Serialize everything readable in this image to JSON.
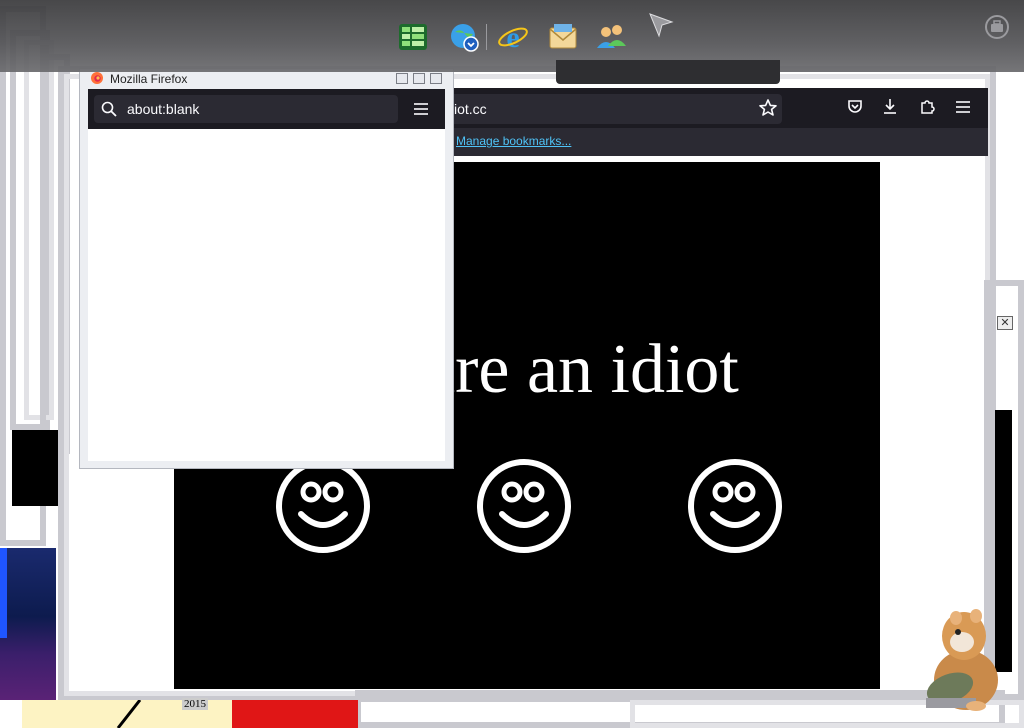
{
  "taskbar": {
    "icons": [
      "spreadsheet-icon",
      "globe-download-icon",
      "internet-explorer-icon",
      "mail-icon",
      "users-icon"
    ]
  },
  "main_browser": {
    "url": "iot.cc",
    "bookmarks_link": "Manage bookmarks...",
    "page_text": "are an idiot"
  },
  "popup_browser": {
    "title": "Mozilla Firefox",
    "url": "about:blank"
  },
  "bottom": {
    "year": "2015"
  },
  "colors": {
    "firefox_toolbar": "#1c1b22",
    "url_bar": "#2b2a33",
    "link": "#4fc3f7",
    "page_bg": "#000000"
  }
}
